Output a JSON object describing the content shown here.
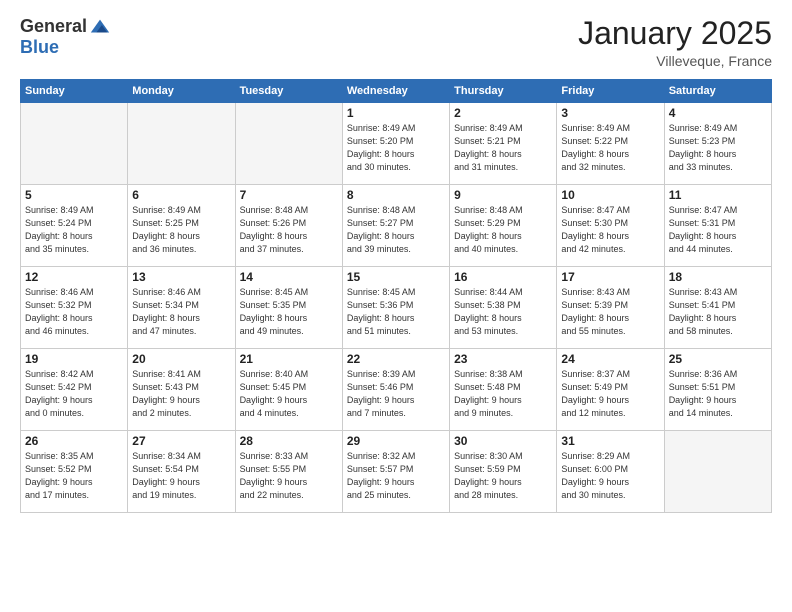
{
  "header": {
    "logo_general": "General",
    "logo_blue": "Blue",
    "month": "January 2025",
    "location": "Villeveque, France"
  },
  "weekdays": [
    "Sunday",
    "Monday",
    "Tuesday",
    "Wednesday",
    "Thursday",
    "Friday",
    "Saturday"
  ],
  "weeks": [
    [
      {
        "day": "",
        "info": ""
      },
      {
        "day": "",
        "info": ""
      },
      {
        "day": "",
        "info": ""
      },
      {
        "day": "1",
        "info": "Sunrise: 8:49 AM\nSunset: 5:20 PM\nDaylight: 8 hours\nand 30 minutes."
      },
      {
        "day": "2",
        "info": "Sunrise: 8:49 AM\nSunset: 5:21 PM\nDaylight: 8 hours\nand 31 minutes."
      },
      {
        "day": "3",
        "info": "Sunrise: 8:49 AM\nSunset: 5:22 PM\nDaylight: 8 hours\nand 32 minutes."
      },
      {
        "day": "4",
        "info": "Sunrise: 8:49 AM\nSunset: 5:23 PM\nDaylight: 8 hours\nand 33 minutes."
      }
    ],
    [
      {
        "day": "5",
        "info": "Sunrise: 8:49 AM\nSunset: 5:24 PM\nDaylight: 8 hours\nand 35 minutes."
      },
      {
        "day": "6",
        "info": "Sunrise: 8:49 AM\nSunset: 5:25 PM\nDaylight: 8 hours\nand 36 minutes."
      },
      {
        "day": "7",
        "info": "Sunrise: 8:48 AM\nSunset: 5:26 PM\nDaylight: 8 hours\nand 37 minutes."
      },
      {
        "day": "8",
        "info": "Sunrise: 8:48 AM\nSunset: 5:27 PM\nDaylight: 8 hours\nand 39 minutes."
      },
      {
        "day": "9",
        "info": "Sunrise: 8:48 AM\nSunset: 5:29 PM\nDaylight: 8 hours\nand 40 minutes."
      },
      {
        "day": "10",
        "info": "Sunrise: 8:47 AM\nSunset: 5:30 PM\nDaylight: 8 hours\nand 42 minutes."
      },
      {
        "day": "11",
        "info": "Sunrise: 8:47 AM\nSunset: 5:31 PM\nDaylight: 8 hours\nand 44 minutes."
      }
    ],
    [
      {
        "day": "12",
        "info": "Sunrise: 8:46 AM\nSunset: 5:32 PM\nDaylight: 8 hours\nand 46 minutes."
      },
      {
        "day": "13",
        "info": "Sunrise: 8:46 AM\nSunset: 5:34 PM\nDaylight: 8 hours\nand 47 minutes."
      },
      {
        "day": "14",
        "info": "Sunrise: 8:45 AM\nSunset: 5:35 PM\nDaylight: 8 hours\nand 49 minutes."
      },
      {
        "day": "15",
        "info": "Sunrise: 8:45 AM\nSunset: 5:36 PM\nDaylight: 8 hours\nand 51 minutes."
      },
      {
        "day": "16",
        "info": "Sunrise: 8:44 AM\nSunset: 5:38 PM\nDaylight: 8 hours\nand 53 minutes."
      },
      {
        "day": "17",
        "info": "Sunrise: 8:43 AM\nSunset: 5:39 PM\nDaylight: 8 hours\nand 55 minutes."
      },
      {
        "day": "18",
        "info": "Sunrise: 8:43 AM\nSunset: 5:41 PM\nDaylight: 8 hours\nand 58 minutes."
      }
    ],
    [
      {
        "day": "19",
        "info": "Sunrise: 8:42 AM\nSunset: 5:42 PM\nDaylight: 9 hours\nand 0 minutes."
      },
      {
        "day": "20",
        "info": "Sunrise: 8:41 AM\nSunset: 5:43 PM\nDaylight: 9 hours\nand 2 minutes."
      },
      {
        "day": "21",
        "info": "Sunrise: 8:40 AM\nSunset: 5:45 PM\nDaylight: 9 hours\nand 4 minutes."
      },
      {
        "day": "22",
        "info": "Sunrise: 8:39 AM\nSunset: 5:46 PM\nDaylight: 9 hours\nand 7 minutes."
      },
      {
        "day": "23",
        "info": "Sunrise: 8:38 AM\nSunset: 5:48 PM\nDaylight: 9 hours\nand 9 minutes."
      },
      {
        "day": "24",
        "info": "Sunrise: 8:37 AM\nSunset: 5:49 PM\nDaylight: 9 hours\nand 12 minutes."
      },
      {
        "day": "25",
        "info": "Sunrise: 8:36 AM\nSunset: 5:51 PM\nDaylight: 9 hours\nand 14 minutes."
      }
    ],
    [
      {
        "day": "26",
        "info": "Sunrise: 8:35 AM\nSunset: 5:52 PM\nDaylight: 9 hours\nand 17 minutes."
      },
      {
        "day": "27",
        "info": "Sunrise: 8:34 AM\nSunset: 5:54 PM\nDaylight: 9 hours\nand 19 minutes."
      },
      {
        "day": "28",
        "info": "Sunrise: 8:33 AM\nSunset: 5:55 PM\nDaylight: 9 hours\nand 22 minutes."
      },
      {
        "day": "29",
        "info": "Sunrise: 8:32 AM\nSunset: 5:57 PM\nDaylight: 9 hours\nand 25 minutes."
      },
      {
        "day": "30",
        "info": "Sunrise: 8:30 AM\nSunset: 5:59 PM\nDaylight: 9 hours\nand 28 minutes."
      },
      {
        "day": "31",
        "info": "Sunrise: 8:29 AM\nSunset: 6:00 PM\nDaylight: 9 hours\nand 30 minutes."
      },
      {
        "day": "",
        "info": ""
      }
    ]
  ]
}
